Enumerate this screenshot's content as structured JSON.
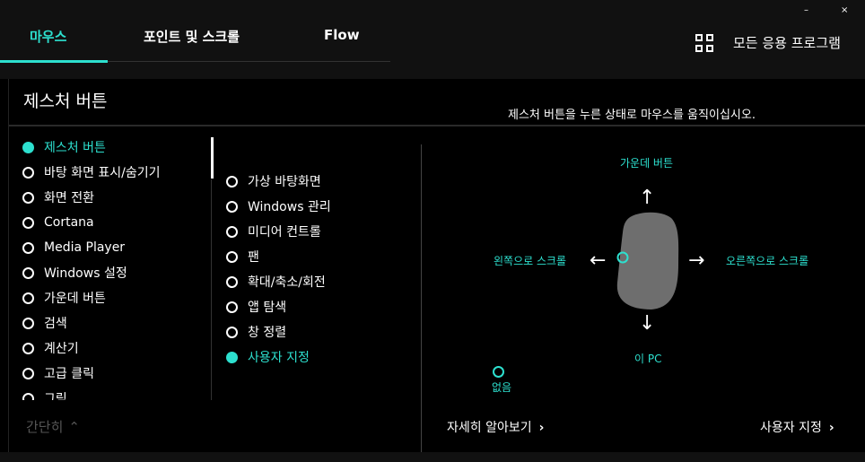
{
  "tabs": [
    {
      "label": "마우스"
    },
    {
      "label": "포인트 및 스크롤"
    },
    {
      "label": "Flow"
    }
  ],
  "header": {
    "apps_label": "모든 응용 프로그램",
    "window_controls": [
      "–",
      "×"
    ]
  },
  "panel": {
    "title": "제스처 버튼",
    "instruction": "제스처 버튼을 누른 상태로 마우스를 움직이십시오.",
    "collapse_label": "간단히"
  },
  "list1": [
    {
      "label": "제스처 버튼",
      "selected": true
    },
    {
      "label": "바탕 화면 표시/숨기기",
      "selected": false
    },
    {
      "label": "화면 전환",
      "selected": false
    },
    {
      "label": "Cortana",
      "selected": false
    },
    {
      "label": "Media Player",
      "selected": false
    },
    {
      "label": "Windows 설정",
      "selected": false
    },
    {
      "label": "가운데 버튼",
      "selected": false
    },
    {
      "label": "검색",
      "selected": false
    },
    {
      "label": "계산기",
      "selected": false
    },
    {
      "label": "고급 클릭",
      "selected": false
    },
    {
      "label": "그림",
      "selected": false
    }
  ],
  "list2": [
    {
      "label": "가상 바탕화면",
      "selected": false
    },
    {
      "label": "Windows 관리",
      "selected": false
    },
    {
      "label": "미디어 컨트롤",
      "selected": false
    },
    {
      "label": "팬",
      "selected": false
    },
    {
      "label": "확대/축소/회전",
      "selected": false
    },
    {
      "label": "앱 탐색",
      "selected": false
    },
    {
      "label": "창 정렬",
      "selected": false
    },
    {
      "label": "사용자 지정",
      "selected": true
    }
  ],
  "gesture": {
    "up": "가운데 버튼",
    "left": "왼쪽으로 스크롤",
    "right": "오른쪽으로 스크롤",
    "down": "이 PC",
    "none": "없음"
  },
  "links": {
    "learn_more": "자세히 알아보기",
    "customize": "사용자 지정"
  },
  "colors": {
    "accent": "#2de0cf",
    "mouse_body": "#6e6e6e"
  }
}
